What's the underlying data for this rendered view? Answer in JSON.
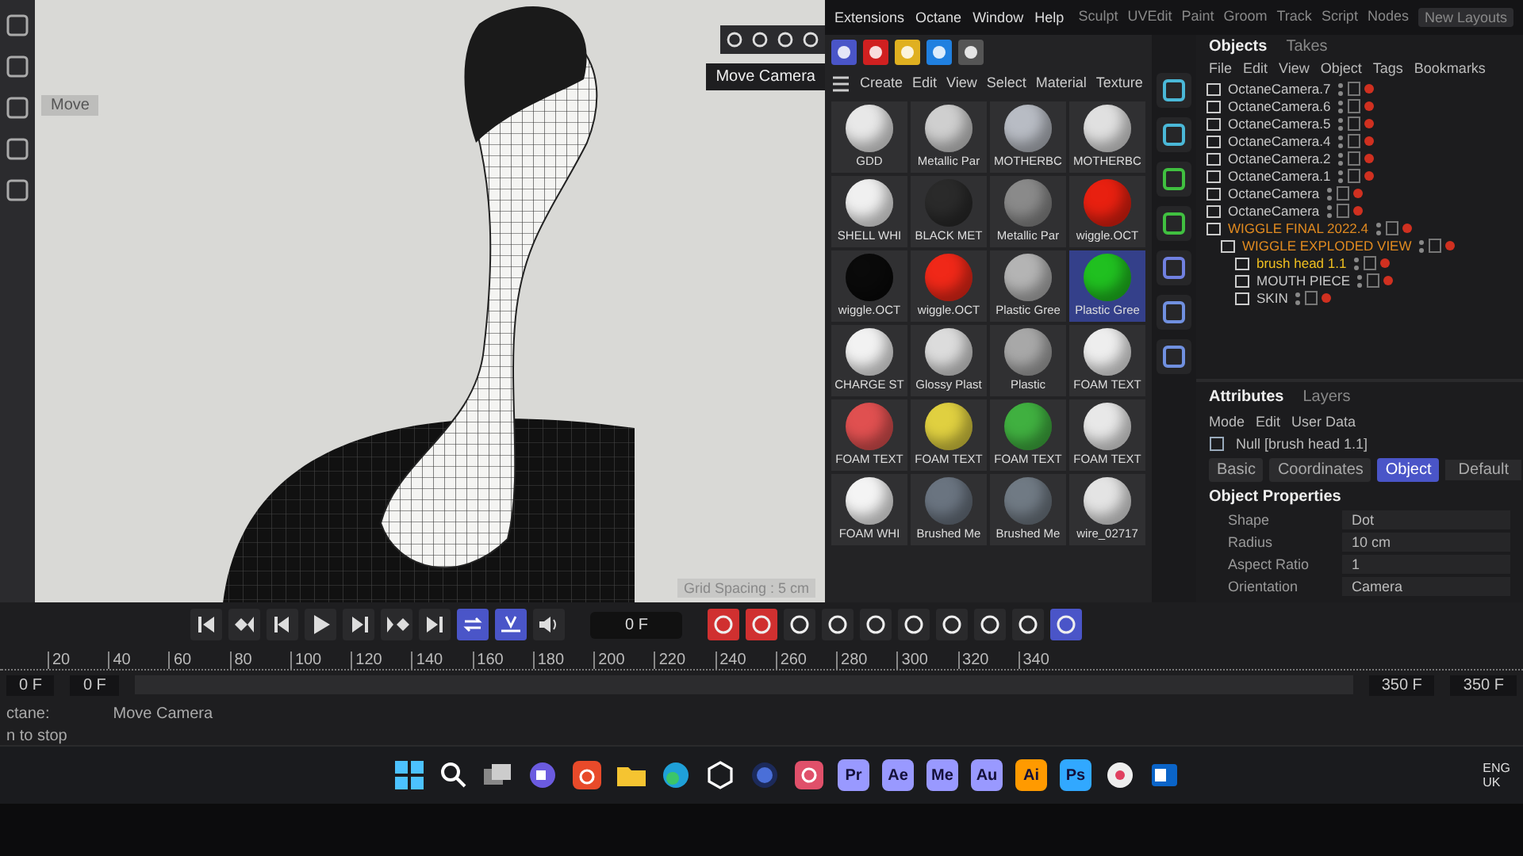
{
  "menu": {
    "items": [
      "Extensions",
      "Octane",
      "Window",
      "Help"
    ],
    "layouts": [
      "Sculpt",
      "UVEdit",
      "Paint",
      "Groom",
      "Track",
      "Script",
      "Nodes"
    ],
    "layout_button": "New Layouts"
  },
  "viewport": {
    "tool_label": "Move",
    "tooltip": "Move Camera",
    "grid_label": "Grid Spacing : 5 cm"
  },
  "materials": {
    "menu": [
      "Create",
      "Edit",
      "View",
      "Select",
      "Material",
      "Texture"
    ],
    "items": [
      {
        "name": "GDD",
        "color": "#e8e8e8",
        "selected": false
      },
      {
        "name": "Metallic Par",
        "color": "#cfcfcf",
        "selected": false
      },
      {
        "name": "MOTHERBC",
        "color": "#b8bcc4",
        "selected": false
      },
      {
        "name": "MOTHERBC",
        "color": "#e0e0e0",
        "selected": false
      },
      {
        "name": "SHELL WHI",
        "color": "#f0f0f0",
        "selected": false
      },
      {
        "name": "BLACK MET",
        "color": "#2a2a2a",
        "selected": false
      },
      {
        "name": "Metallic Par",
        "color": "#8a8a8a",
        "selected": false
      },
      {
        "name": "wiggle.OCT",
        "color": "#e82010",
        "selected": false
      },
      {
        "name": "wiggle.OCT",
        "color": "#0a0a0a",
        "selected": false
      },
      {
        "name": "wiggle.OCT",
        "color": "#f02818",
        "selected": false
      },
      {
        "name": "Plastic Gree",
        "color": "#b4b4b4",
        "selected": false
      },
      {
        "name": "Plastic Gree",
        "color": "#20c020",
        "selected": true
      },
      {
        "name": "CHARGE ST",
        "color": "#f2f2f2",
        "selected": false
      },
      {
        "name": "Glossy Plast",
        "color": "#dcdcdc",
        "selected": false
      },
      {
        "name": "Plastic",
        "color": "#a8a8a8",
        "selected": false
      },
      {
        "name": "FOAM TEXT",
        "color": "#eeeeee",
        "selected": false
      },
      {
        "name": "FOAM TEXT",
        "color": "#e05050",
        "selected": false
      },
      {
        "name": "FOAM TEXT",
        "color": "#e0d040",
        "selected": false
      },
      {
        "name": "FOAM TEXT",
        "color": "#40b040",
        "selected": false
      },
      {
        "name": "FOAM TEXT",
        "color": "#e8e8e8",
        "selected": false
      },
      {
        "name": "FOAM WHI",
        "color": "#f4f4f4",
        "selected": false
      },
      {
        "name": "Brushed Me",
        "color": "#6a7480",
        "selected": false
      },
      {
        "name": "Brushed Me",
        "color": "#707a84",
        "selected": false
      },
      {
        "name": "wire_02717",
        "color": "#e4e4e4",
        "selected": false
      }
    ]
  },
  "objects": {
    "tabs": [
      {
        "label": "Objects",
        "selected": true
      },
      {
        "label": "Takes",
        "selected": false
      }
    ],
    "menu": [
      "File",
      "Edit",
      "View",
      "Object",
      "Tags",
      "Bookmarks"
    ],
    "items": [
      {
        "name": "OctaneCamera.7",
        "color": "#c8c8c8"
      },
      {
        "name": "OctaneCamera.6",
        "color": "#c8c8c8"
      },
      {
        "name": "OctaneCamera.5",
        "color": "#c8c8c8"
      },
      {
        "name": "OctaneCamera.4",
        "color": "#c8c8c8"
      },
      {
        "name": "OctaneCamera.2",
        "color": "#c8c8c8"
      },
      {
        "name": "OctaneCamera.1",
        "color": "#c8c8c8"
      },
      {
        "name": "OctaneCamera",
        "color": "#c8c8c8"
      },
      {
        "name": "OctaneCamera",
        "color": "#c8c8c8"
      },
      {
        "name": "WIGGLE FINAL 2022.4",
        "color": "#e08a20",
        "children": [
          {
            "name": "WIGGLE EXPLODED VIEW",
            "color": "#e08a20",
            "children": [
              {
                "name": "brush head 1.1",
                "color": "#f0c020"
              },
              {
                "name": "MOUTH PIECE",
                "color": "#c8c8c8"
              },
              {
                "name": "SKIN",
                "color": "#c8c8c8"
              }
            ]
          }
        ]
      }
    ]
  },
  "attributes": {
    "tabs": [
      {
        "label": "Attributes",
        "selected": true
      },
      {
        "label": "Layers",
        "selected": false
      }
    ],
    "menu": [
      "Mode",
      "Edit",
      "User Data"
    ],
    "object": "Null [brush head 1.1]",
    "subtabs": [
      {
        "label": "Basic",
        "selected": false
      },
      {
        "label": "Coordinates",
        "selected": false
      },
      {
        "label": "Object",
        "selected": true
      }
    ],
    "preset": "Default",
    "section": "Object Properties",
    "fields": [
      {
        "label": "Shape",
        "value": "Dot"
      },
      {
        "label": "Radius",
        "value": "10 cm"
      },
      {
        "label": "Aspect Ratio",
        "value": "1"
      },
      {
        "label": "Orientation",
        "value": "Camera"
      }
    ]
  },
  "timeline": {
    "current_frame": "0 F",
    "ruler": [
      "20",
      "40",
      "60",
      "80",
      "100",
      "120",
      "140",
      "160",
      "180",
      "200",
      "220",
      "240",
      "260",
      "280",
      "300",
      "320",
      "340"
    ],
    "start": "0 F",
    "start_preview": "0 F",
    "end_preview": "350 F",
    "end": "350 F"
  },
  "status": {
    "left": "ctane:",
    "message": "Move Camera",
    "hint": "n to stop"
  },
  "taskbar": {
    "apps": [
      {
        "label": "Pr",
        "color": "#9999ff"
      },
      {
        "label": "Ae",
        "color": "#9999ff"
      },
      {
        "label": "Me",
        "color": "#9999ff"
      },
      {
        "label": "Au",
        "color": "#9999ff"
      },
      {
        "label": "Ai",
        "color": "#ff9a00"
      },
      {
        "label": "Ps",
        "color": "#31a8ff"
      }
    ],
    "language": "ENG",
    "region": "UK"
  }
}
